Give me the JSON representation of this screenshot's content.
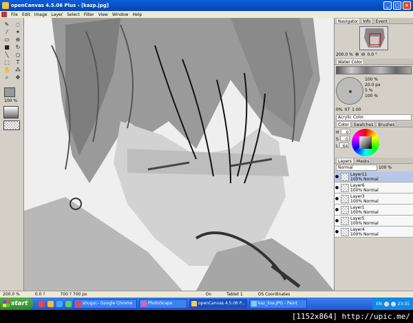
{
  "window": {
    "title": "openCanvas 4.5.06 Plus - [kazp.jpg]"
  },
  "menu": [
    "File",
    "Edit",
    "Image",
    "Layer",
    "Select",
    "Filter",
    "View",
    "Window",
    "Help"
  ],
  "toolbox": {
    "zoom": "100",
    "zoom_unit": "%"
  },
  "navigator": {
    "tabs": [
      "Navigator",
      "Info",
      "Event"
    ],
    "zoom": "200.0",
    "zoom_unit": "%",
    "angle": "0.0",
    "angle_unit": "°"
  },
  "brush": {
    "tab": "Water Color",
    "size": "100",
    "size_unit": "%",
    "width": "20.0",
    "width_unit": "px",
    "opacity": "5",
    "opacity_unit": "%",
    "density": "100",
    "density_unit": "%",
    "vals": [
      "0%",
      "07",
      "1.00"
    ],
    "preset": "Acrylic Color"
  },
  "color": {
    "tabs": [
      "Color",
      "Swatches",
      "Brushes"
    ],
    "h": "0",
    "s": "0",
    "l": "64"
  },
  "layers": {
    "tabs": [
      "Layers",
      "Masks"
    ],
    "blend": "Normal",
    "opacity": "100",
    "opacity_unit": "%",
    "items": [
      {
        "name": "Layer11",
        "mode": "100% Normal",
        "selected": true
      },
      {
        "name": "Layer6",
        "mode": "100% Normal",
        "selected": false
      },
      {
        "name": "Layer3",
        "mode": "100% Normal",
        "selected": false
      },
      {
        "name": "Layer1",
        "mode": "100% Normal",
        "selected": false
      },
      {
        "name": "Layer5",
        "mode": "100% Normal",
        "selected": false
      },
      {
        "name": "Layer4",
        "mode": "100% Normal",
        "selected": false
      }
    ]
  },
  "status": {
    "zoom": "200.0 %",
    "angle": "0.0 ?",
    "size": "700 ? 700 px",
    "pen": "On",
    "tablet": "Tablet 1",
    "coords": "OS Coordinates"
  },
  "taskbar": {
    "start": "start",
    "tasks": [
      "shugui - Google Chrome",
      "PhotoScape",
      "openCanvas 4.5.06 P...",
      "kaz_line.JPG - Paint"
    ],
    "lang": "EN",
    "time": "23:31"
  },
  "watermark": "[1152x864] http://upic.me/",
  "colors": {
    "titlebar": "#0a5fd8",
    "taskbar": "#245edb",
    "start": "#3c9a35",
    "canvas_bg": "#efefef"
  }
}
